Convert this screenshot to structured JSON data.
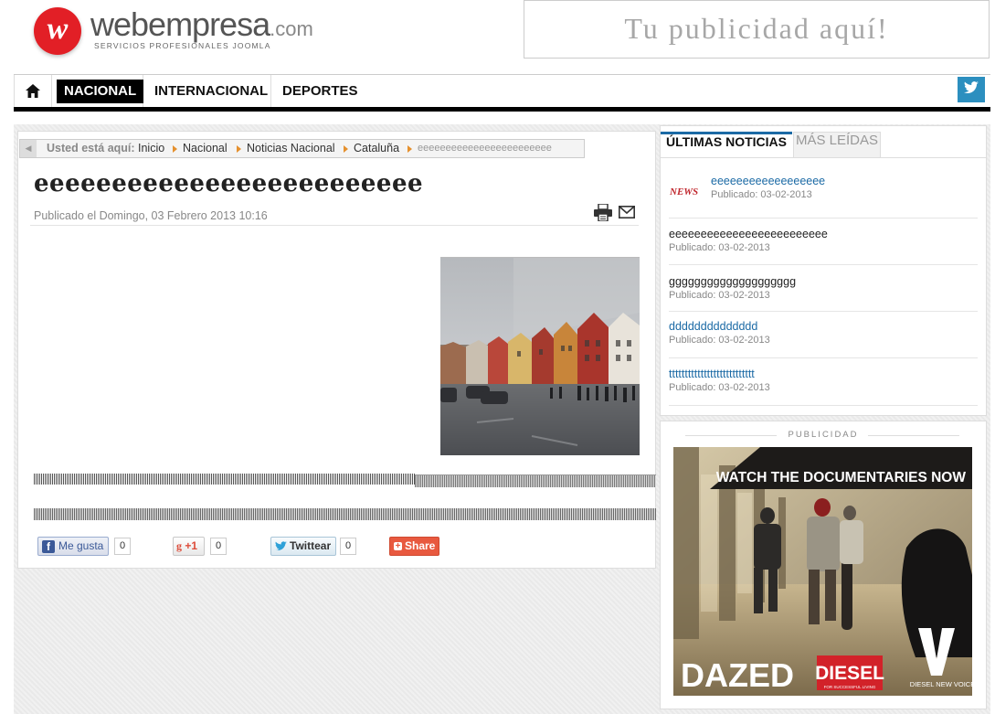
{
  "header": {
    "logo_letter": "w",
    "logo_word": "webempresa",
    "logo_tld": ".com",
    "logo_tagline": "SERVICIOS PROFESIONALES JOOMLA",
    "ad_text": "Tu publicidad aquí!"
  },
  "nav": {
    "home_icon": "home-icon",
    "items": [
      "NACIONAL",
      "INTERNACIONAL",
      "DEPORTES"
    ],
    "active": "NACIONAL",
    "twitter_icon": "twitter-icon"
  },
  "breadcrumb": {
    "label": "Usted está aquí:",
    "items": [
      "Inicio",
      "Nacional",
      "Noticias Nacional",
      "Cataluña",
      "eeeeeeeeeeeeeeeeeeeeeeee"
    ]
  },
  "article": {
    "title": "eeeeeeeeeeeeeeeeeeeeeeeee",
    "published": "Publicado el Domingo, 03 Febrero 2013 10:16",
    "print_icon": "print-icon",
    "email_icon": "email-icon"
  },
  "social": {
    "facebook_label": "Me gusta",
    "facebook_count": "0",
    "gplus_label": "+1",
    "gplus_count": "0",
    "twitter_label": "Twittear",
    "twitter_count": "0",
    "share_label": "Share"
  },
  "sidebar": {
    "tabs": [
      "ÚLTIMAS NOTICIAS",
      "MÁS LEÍDAS"
    ],
    "active_tab": "ÚLTIMAS NOTICIAS",
    "thumb_text": "NEWS",
    "news": [
      {
        "title": "eeeeeeeeeeeeeeeeee",
        "date": "Publicado: 03-02-2013"
      },
      {
        "title": "eeeeeeeeeeeeeeeeeeeeeeeee",
        "date": "Publicado: 03-02-2013"
      },
      {
        "title": "gggggggggggggggggggg",
        "date": "Publicado: 03-02-2013"
      },
      {
        "title": "dddddddddddddd",
        "date": "Publicado: 03-02-2013"
      },
      {
        "title": "ttttttttttttttttttttttttttt",
        "date": "Publicado: 03-02-2013"
      }
    ],
    "ad_label": "PUBLICIDAD",
    "ad": {
      "headline": "WATCH THE DOCUMENTARIES NOW",
      "brand1": "DAZED",
      "brand2": "DIESEL",
      "brand2_sub": "FOR SUCCESSFUL LIVING",
      "brand3_sub": "DIESEL NEW VOICES"
    }
  },
  "colors": {
    "accent_blue": "#1b6aa5",
    "breadcrumb_arrow": "#e5902d",
    "logo_red": "#e21f26"
  }
}
